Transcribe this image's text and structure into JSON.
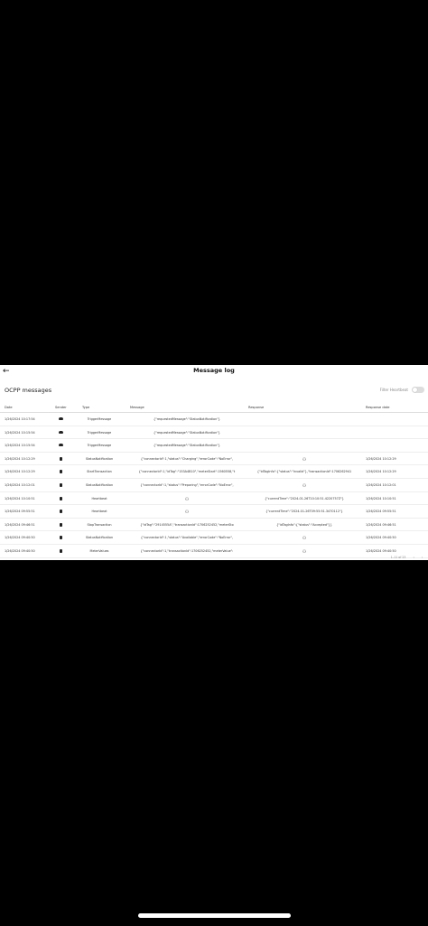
{
  "app": {
    "title": "Message log",
    "back_icon": "arrow-left-icon"
  },
  "section": {
    "title": "OCPP messages",
    "filter_label": "Filter Heartbeat",
    "filter_on": false
  },
  "table": {
    "headers": {
      "date": "Date",
      "sender": "Sender",
      "type": "Type",
      "message": "Message",
      "response": "Response",
      "response_date": "Response date"
    },
    "rows": [
      {
        "date": "1/26/2024 10:17:54",
        "sender_icon": "cloud-icon",
        "type": "TriggerMessage",
        "message": "{\"requestedMessage\":\"StatusNotification\"}",
        "response": "",
        "response_date": ""
      },
      {
        "date": "1/26/2024 10:15:54",
        "sender_icon": "cloud-icon",
        "type": "TriggerMessage",
        "message": "{\"requestedMessage\":\"StatusNotification\"}",
        "response": "",
        "response_date": ""
      },
      {
        "date": "1/26/2024 10:15:54",
        "sender_icon": "cloud-icon",
        "type": "TriggerMessage",
        "message": "{\"requestedMessage\":\"StatusNotification\"}",
        "response": "",
        "response_date": ""
      },
      {
        "date": "1/26/2024 10:12:29",
        "sender_icon": "charger-icon",
        "type": "StatusNotification",
        "message": "{\"connectorId\":1,\"status\":\"Charging\",\"errorCode\":\"NoError\",",
        "response": "{}",
        "response_date": "1/26/2024 10:12:29"
      },
      {
        "date": "1/26/2024 10:12:29",
        "sender_icon": "charger-icon",
        "type": "StartTransaction",
        "message": "{\"connectorId\":1,\"idTag\":\"153A4B10\",\"meterStart\":1560558,\"t",
        "response": "{\"idTagInfo\":{\"status\":\"Invalid\"},\"transactionId\":1706262941",
        "response_date": "1/26/2024 10:12:29"
      },
      {
        "date": "1/26/2024 10:12:01",
        "sender_icon": "charger-icon",
        "type": "StatusNotification",
        "message": "{\"connectorId\":1,\"status\":\"Preparing\",\"errorCode\":\"NoError\",",
        "response": "{}",
        "response_date": "1/26/2024 10:12:01"
      },
      {
        "date": "1/26/2024 10:10:51",
        "sender_icon": "charger-icon",
        "type": "Heartbeat",
        "message": "{}",
        "response": "{\"currentTime\":\"2024-01-26T10:10:51.4220757Z\"}",
        "response_date": "1/26/2024 10:10:51"
      },
      {
        "date": "1/26/2024 09:55:51",
        "sender_icon": "charger-icon",
        "type": "Heartbeat",
        "message": "{}",
        "response": "{\"currentTime\":\"2024-01-26T09:55:51.3470112\"}",
        "response_date": "1/26/2024 09:55:51"
      },
      {
        "date": "1/26/2024 09:46:51",
        "sender_icon": "charger-icon",
        "type": "StopTransaction",
        "message": "{\"idTag\":\"2914555A\",\"transactionId\":1706252452,\"meterSto",
        "response": "{\"idTagInfo\":{\"status\":\"Accepted\"}}",
        "response_date": "1/26/2024 09:46:51"
      },
      {
        "date": "1/26/2024 09:40:50",
        "sender_icon": "charger-icon",
        "type": "StatusNotification",
        "message": "{\"connectorId\":1,\"status\":\"Available\",\"errorCode\":\"NoError\",",
        "response": "{}",
        "response_date": "1/26/2024 09:40:50"
      },
      {
        "date": "1/26/2024 09:40:50",
        "sender_icon": "charger-icon",
        "type": "MeterValues",
        "message": "{\"connectorId\":1,\"transactionId\":1706252452,\"meterValue\":",
        "response": "{}",
        "response_date": "1/26/2024 09:40:50"
      }
    ]
  },
  "pagination": {
    "label": "1–11 of 23",
    "prev_icon": "chevron-left-icon",
    "next_icon": "chevron-right-icon"
  }
}
